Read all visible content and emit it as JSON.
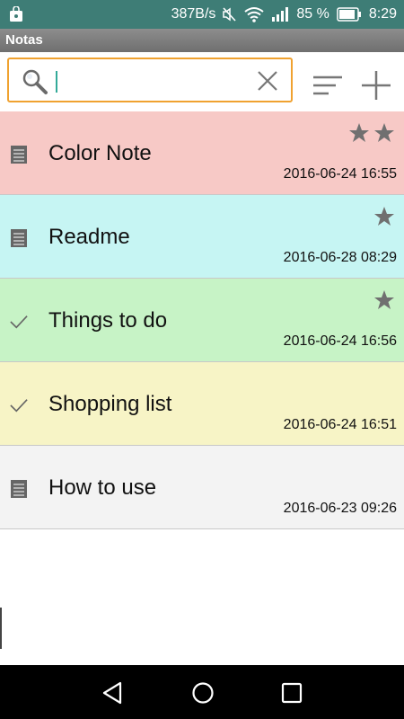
{
  "status_bar": {
    "network_speed": "387B/s",
    "battery": "85 %",
    "time": "8:29"
  },
  "app": {
    "title": "Notas"
  },
  "search": {
    "value": "",
    "placeholder": ""
  },
  "notes": [
    {
      "title": "Color Note",
      "date": "2016-06-24 16:55",
      "stars": 2,
      "type": "text",
      "color": "#f7c9c6"
    },
    {
      "title": "Readme",
      "date": "2016-06-28 08:29",
      "stars": 1,
      "type": "text",
      "color": "#c6f5f3"
    },
    {
      "title": "Things to do",
      "date": "2016-06-24 16:56",
      "stars": 1,
      "type": "checklist",
      "color": "#c7f3c6"
    },
    {
      "title": "Shopping list",
      "date": "2016-06-24 16:51",
      "stars": 0,
      "type": "checklist",
      "color": "#f7f4c6"
    },
    {
      "title": "How to use",
      "date": "2016-06-23 09:26",
      "stars": 0,
      "type": "text",
      "color": "#f3f3f3"
    }
  ],
  "colors": {
    "status_bar": "#3e7d76",
    "search_border": "#f0a230",
    "icon_gray": "#777777"
  }
}
